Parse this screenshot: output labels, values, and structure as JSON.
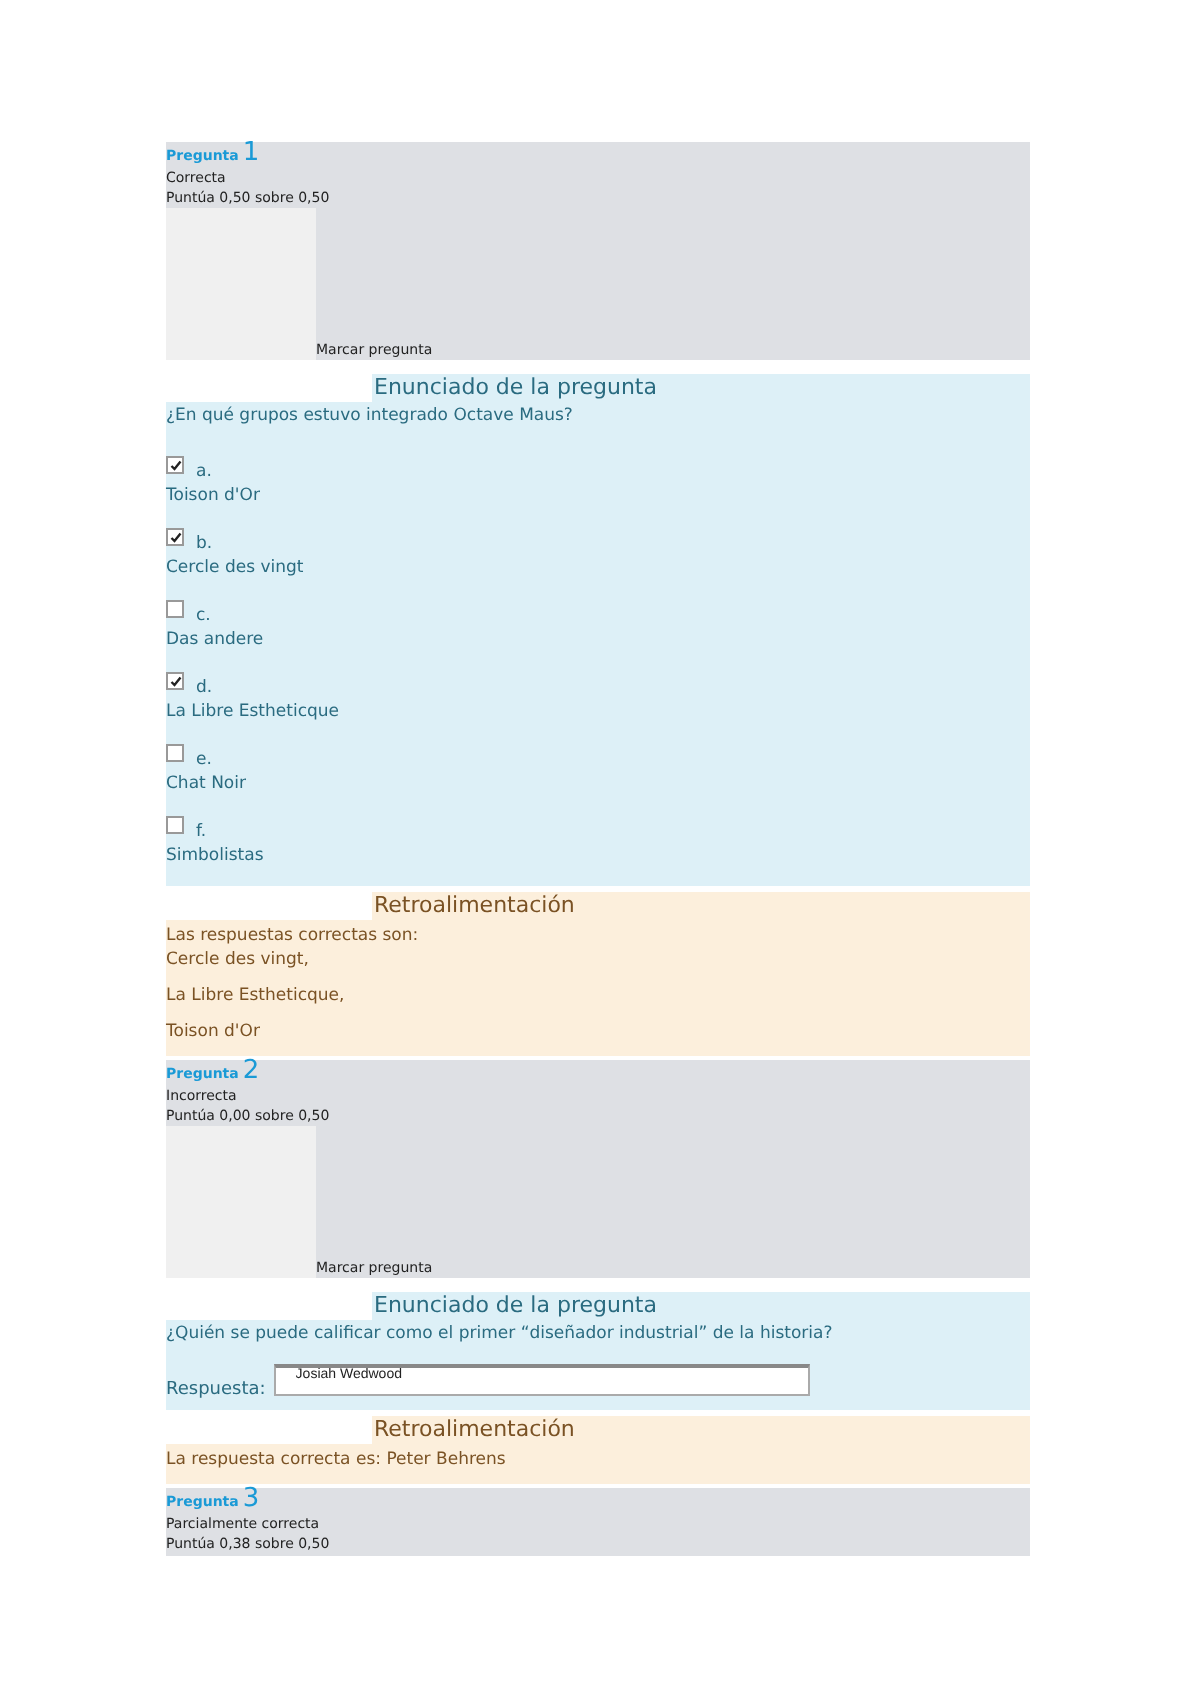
{
  "questions": [
    {
      "label": "Pregunta",
      "number": "1",
      "state": "Correcta",
      "grade": "Puntúa 0,50 sobre 0,50",
      "flag": "Marcar pregunta",
      "content": {
        "kind": "multichoice",
        "heading": "Enunciado de la pregunta",
        "text": "¿En qué grupos estuvo integrado Octave Maus?",
        "options": [
          {
            "letter": "a.",
            "label": "Toison d'Or",
            "checked": true
          },
          {
            "letter": "b.",
            "label": "Cercle des vingt",
            "checked": true
          },
          {
            "letter": "c.",
            "label": "Das andere",
            "checked": false
          },
          {
            "letter": "d.",
            "label": "La Libre Estheticque",
            "checked": true
          },
          {
            "letter": "e.",
            "label": "Chat Noir",
            "checked": false
          },
          {
            "letter": "f.",
            "label": "Simbolistas",
            "checked": false
          }
        ]
      },
      "feedback": {
        "heading": "Retroalimentación",
        "lines": [
          "Las respuestas correctas son:",
          "Cercle des vingt,",
          "La Libre Estheticque,",
          "Toison d'Or"
        ]
      }
    },
    {
      "label": "Pregunta",
      "number": "2",
      "state": "Incorrecta",
      "grade": "Puntúa 0,00 sobre 0,50",
      "flag": "Marcar pregunta",
      "content": {
        "kind": "shortanswer",
        "heading": "Enunciado de la pregunta",
        "text": "¿Quién se puede calificar como el primer “diseñador industrial” de la historia?",
        "answer_label": "Respuesta:",
        "answer": "Josiah Wedwood"
      },
      "feedback": {
        "heading": "Retroalimentación",
        "lines": [
          "La respuesta correcta es: Peter Behrens"
        ]
      }
    },
    {
      "label": "Pregunta",
      "number": "3",
      "state": "Parcialmente correcta",
      "grade": "Puntúa 0,38 sobre 0,50"
    }
  ]
}
